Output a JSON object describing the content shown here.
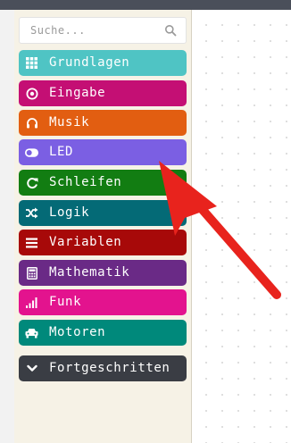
{
  "search": {
    "placeholder": "Suche..."
  },
  "categories": [
    {
      "label": "Grundlagen",
      "color": "#4fc4c4",
      "icon": "grid-icon"
    },
    {
      "label": "Eingabe",
      "color": "#c40f74",
      "icon": "target-icon"
    },
    {
      "label": "Musik",
      "color": "#e25e11",
      "icon": "headphones-icon"
    },
    {
      "label": "LED",
      "color": "#7b5fe3",
      "icon": "toggle-icon"
    },
    {
      "label": "Schleifen",
      "color": "#127d12",
      "icon": "loop-arrow-icon"
    },
    {
      "label": "Logik",
      "color": "#046a76",
      "icon": "shuffle-icon"
    },
    {
      "label": "Variablen",
      "color": "#a70909",
      "icon": "list-icon"
    },
    {
      "label": "Mathematik",
      "color": "#6a2a86",
      "icon": "calculator-icon"
    },
    {
      "label": "Funk",
      "color": "#e3138e",
      "icon": "signal-bars-icon"
    },
    {
      "label": "Motoren",
      "color": "#00897b",
      "icon": "car-icon"
    },
    {
      "label": "Fortgeschritten",
      "color": "#3a3d44",
      "icon": "chevron-down-icon"
    }
  ],
  "colors": {
    "arrow": "#e8231d",
    "toolbox_bg": "#f6f2e6",
    "topbar": "#4a4f5a"
  }
}
